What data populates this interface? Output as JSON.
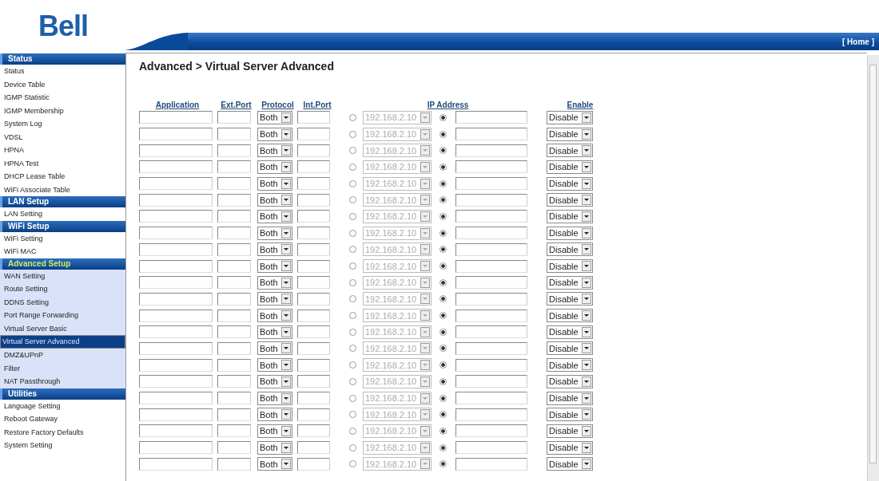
{
  "header": {
    "logo": "Bell",
    "home_link": "[ Home ]"
  },
  "sidebar": {
    "sections": [
      {
        "title": "Status",
        "active": false,
        "items": [
          {
            "label": "Status",
            "selected": false
          },
          {
            "label": "Device Table",
            "selected": false
          },
          {
            "label": "IGMP Statistic",
            "selected": false
          },
          {
            "label": "IGMP Membership",
            "selected": false
          },
          {
            "label": "System Log",
            "selected": false
          },
          {
            "label": "VDSL",
            "selected": false
          },
          {
            "label": "HPNA",
            "selected": false
          },
          {
            "label": "HPNA Test",
            "selected": false
          },
          {
            "label": "DHCP Lease Table",
            "selected": false
          },
          {
            "label": "WiFi Associate Table",
            "selected": false
          }
        ]
      },
      {
        "title": "LAN Setup",
        "active": false,
        "items": [
          {
            "label": "LAN Setting",
            "selected": false
          }
        ]
      },
      {
        "title": "WiFi Setup",
        "active": false,
        "items": [
          {
            "label": "WiFi Setting",
            "selected": false
          },
          {
            "label": "WiFi MAC",
            "selected": false
          }
        ]
      },
      {
        "title": "Advanced Setup",
        "active": true,
        "items": [
          {
            "label": "WAN Setting",
            "selected": false
          },
          {
            "label": "Route Setting",
            "selected": false
          },
          {
            "label": "DDNS Setting",
            "selected": false
          },
          {
            "label": "Port Range Forwarding",
            "selected": false
          },
          {
            "label": "Virtual Server Basic",
            "selected": false
          },
          {
            "label": "Virtual Server Advanced",
            "selected": true
          },
          {
            "label": "DMZ&UPnP",
            "selected": false
          },
          {
            "label": "Filter",
            "selected": false
          },
          {
            "label": "NAT Passthrough",
            "selected": false
          }
        ]
      },
      {
        "title": "Utilities",
        "active": false,
        "items": [
          {
            "label": "Language Setting",
            "selected": false
          },
          {
            "label": "Reboot Gateway",
            "selected": false
          },
          {
            "label": "Restore Factory Defaults",
            "selected": false
          },
          {
            "label": "System Setting",
            "selected": false
          }
        ]
      }
    ]
  },
  "page_title": "Advanced > Virtual Server Advanced",
  "table": {
    "columns": [
      "Application",
      "Ext.Port",
      "Protocol",
      "Int.Port",
      "IP Address",
      "Enable"
    ],
    "rows": [
      {
        "protocol": "Both",
        "ip_list_selected": false,
        "ip_list": "192.168.2.10",
        "ip_manual_selected": true,
        "enable": "Disable"
      },
      {
        "protocol": "Both",
        "ip_list_selected": false,
        "ip_list": "192.168.2.10",
        "ip_manual_selected": true,
        "enable": "Disable"
      },
      {
        "protocol": "Both",
        "ip_list_selected": false,
        "ip_list": "192.168.2.10",
        "ip_manual_selected": true,
        "enable": "Disable"
      },
      {
        "protocol": "Both",
        "ip_list_selected": false,
        "ip_list": "192.168.2.10",
        "ip_manual_selected": true,
        "enable": "Disable"
      },
      {
        "protocol": "Both",
        "ip_list_selected": false,
        "ip_list": "192.168.2.10",
        "ip_manual_selected": true,
        "enable": "Disable"
      },
      {
        "protocol": "Both",
        "ip_list_selected": false,
        "ip_list": "192.168.2.10",
        "ip_manual_selected": true,
        "enable": "Disable"
      },
      {
        "protocol": "Both",
        "ip_list_selected": false,
        "ip_list": "192.168.2.10",
        "ip_manual_selected": true,
        "enable": "Disable"
      },
      {
        "protocol": "Both",
        "ip_list_selected": false,
        "ip_list": "192.168.2.10",
        "ip_manual_selected": true,
        "enable": "Disable"
      },
      {
        "protocol": "Both",
        "ip_list_selected": false,
        "ip_list": "192.168.2.10",
        "ip_manual_selected": true,
        "enable": "Disable"
      },
      {
        "protocol": "Both",
        "ip_list_selected": false,
        "ip_list": "192.168.2.10",
        "ip_manual_selected": true,
        "enable": "Disable"
      },
      {
        "protocol": "Both",
        "ip_list_selected": false,
        "ip_list": "192.168.2.10",
        "ip_manual_selected": true,
        "enable": "Disable"
      },
      {
        "protocol": "Both",
        "ip_list_selected": false,
        "ip_list": "192.168.2.10",
        "ip_manual_selected": true,
        "enable": "Disable"
      },
      {
        "protocol": "Both",
        "ip_list_selected": false,
        "ip_list": "192.168.2.10",
        "ip_manual_selected": true,
        "enable": "Disable"
      },
      {
        "protocol": "Both",
        "ip_list_selected": false,
        "ip_list": "192.168.2.10",
        "ip_manual_selected": true,
        "enable": "Disable"
      },
      {
        "protocol": "Both",
        "ip_list_selected": false,
        "ip_list": "192.168.2.10",
        "ip_manual_selected": true,
        "enable": "Disable"
      },
      {
        "protocol": "Both",
        "ip_list_selected": false,
        "ip_list": "192.168.2.10",
        "ip_manual_selected": true,
        "enable": "Disable"
      },
      {
        "protocol": "Both",
        "ip_list_selected": false,
        "ip_list": "192.168.2.10",
        "ip_manual_selected": true,
        "enable": "Disable"
      },
      {
        "protocol": "Both",
        "ip_list_selected": false,
        "ip_list": "192.168.2.10",
        "ip_manual_selected": true,
        "enable": "Disable"
      },
      {
        "protocol": "Both",
        "ip_list_selected": false,
        "ip_list": "192.168.2.10",
        "ip_manual_selected": true,
        "enable": "Disable"
      },
      {
        "protocol": "Both",
        "ip_list_selected": false,
        "ip_list": "192.168.2.10",
        "ip_manual_selected": true,
        "enable": "Disable"
      },
      {
        "protocol": "Both",
        "ip_list_selected": false,
        "ip_list": "192.168.2.10",
        "ip_manual_selected": true,
        "enable": "Disable"
      },
      {
        "protocol": "Both",
        "ip_list_selected": false,
        "ip_list": "192.168.2.10",
        "ip_manual_selected": true,
        "enable": "Disable"
      }
    ]
  }
}
